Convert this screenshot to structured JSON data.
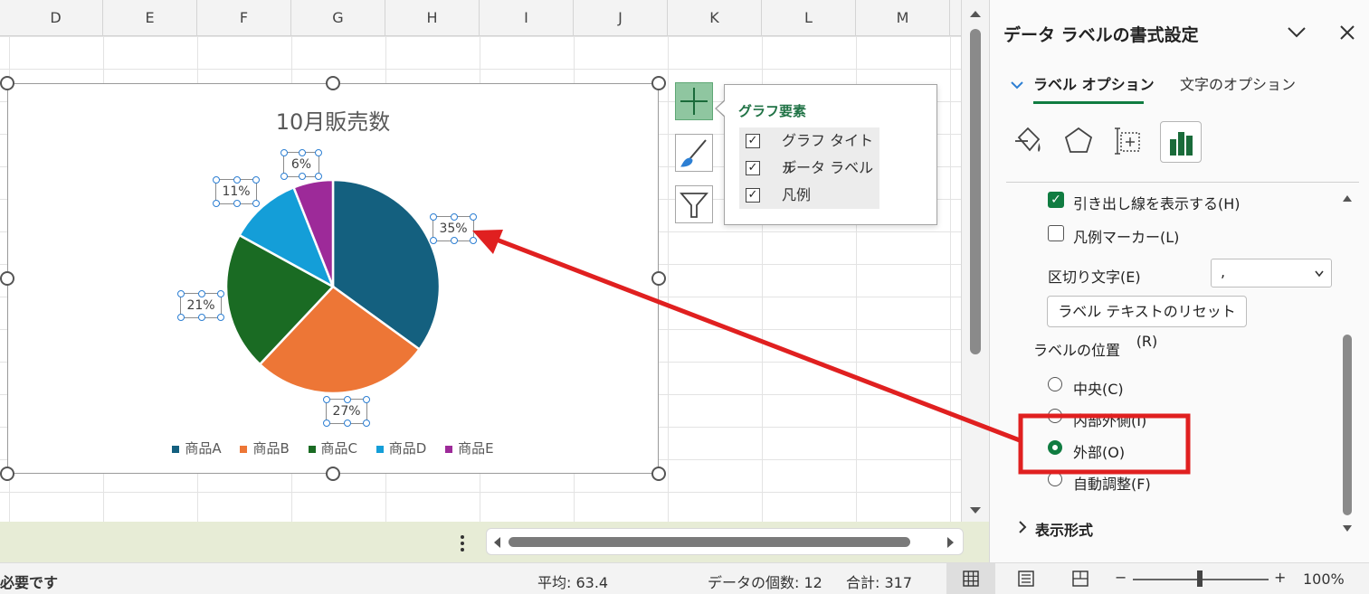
{
  "columns": [
    "D",
    "E",
    "F",
    "G",
    "H",
    "I",
    "J",
    "K",
    "L",
    "M"
  ],
  "chart": {
    "title": "10月販売数",
    "legend": [
      "商品A",
      "商品B",
      "商品C",
      "商品D",
      "商品E"
    ],
    "colors": [
      "#14607f",
      "#ed7636",
      "#1a6b23",
      "#149ed8",
      "#9d2a99"
    ],
    "labels": [
      "35%",
      "27%",
      "21%",
      "11%",
      "6%"
    ]
  },
  "chart_data": {
    "type": "pie",
    "title": "10月販売数",
    "categories": [
      "商品A",
      "商品B",
      "商品C",
      "商品D",
      "商品E"
    ],
    "values": [
      35,
      27,
      21,
      11,
      6
    ],
    "value_labels": [
      "35%",
      "27%",
      "21%",
      "11%",
      "6%"
    ],
    "legend_position": "bottom"
  },
  "popup": {
    "title": "グラフ要素",
    "items": [
      {
        "label": "グラフ タイトル",
        "checked": true
      },
      {
        "label": "データ ラベル",
        "checked": true
      },
      {
        "label": "凡例",
        "checked": true
      }
    ],
    "check_mark": "✓"
  },
  "pane": {
    "title": "データ ラベルの書式設定",
    "tab_label_options": "ラベル オプション",
    "tab_text_options": "文字のオプション",
    "leader_lines": "引き出し線を表示する(H)",
    "legend_marker": "凡例マーカー(L)",
    "separator_label": "区切り文字(E)",
    "separator_value": ",",
    "reset_button": "ラベル テキストのリセット(R)",
    "position_heading": "ラベルの位置",
    "positions": [
      {
        "label": "中央(C)",
        "selected": false
      },
      {
        "label": "内部外側(I)",
        "selected": false
      },
      {
        "label": "外部(O)",
        "selected": true
      },
      {
        "label": "自動調整(F)",
        "selected": false
      }
    ],
    "number_format": "表示形式"
  },
  "status": {
    "left_text": "必要です",
    "average": "平均: 63.4",
    "count": "データの個数: 12",
    "sum": "合計: 317",
    "zoom": "100%",
    "zoom_minus": "−",
    "zoom_plus": "+"
  },
  "annotation_color": "#e02020"
}
